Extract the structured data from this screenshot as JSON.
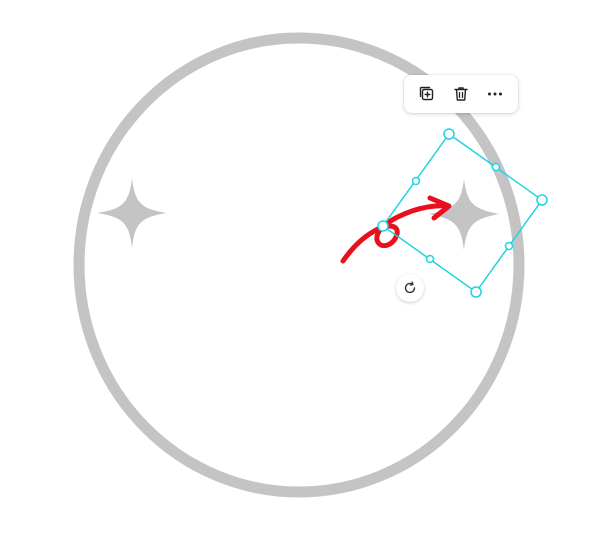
{
  "canvas": {
    "ring_color": "#c4c4c4",
    "sparkle_color": "#c4c4c4",
    "selection_color": "#1ed3e3",
    "arrow_color": "#e8101c",
    "background": "#ffffff"
  },
  "toolbar": {
    "buttons": [
      {
        "name": "duplicate",
        "icon": "duplicate-icon"
      },
      {
        "name": "delete",
        "icon": "trash-icon"
      },
      {
        "name": "more",
        "icon": "more-horizontal-icon"
      }
    ]
  },
  "rotate_handle": {
    "icon": "rotate-icon"
  }
}
